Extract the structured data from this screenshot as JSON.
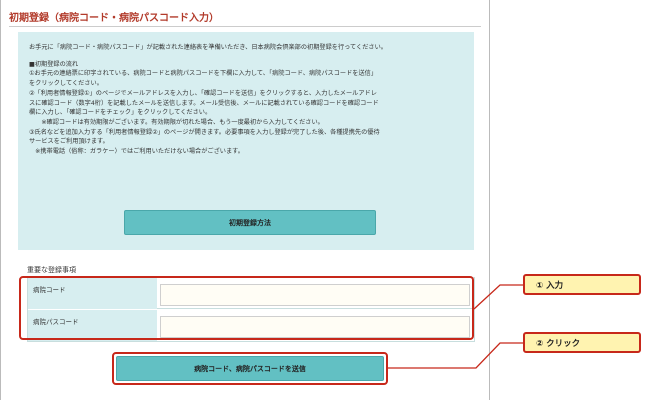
{
  "page": {
    "title": "初期登録（病院コード・病院パスコード入力）"
  },
  "info": {
    "intro": "お手元に「病院コード・病院パスコード」が記載された連絡表を準備いただき、日本病院会倶楽部の初期登録を行ってください。",
    "flow_heading": "■初期登録の流れ",
    "steps": [
      "①お手元の連絡票に印字されている、病院コードと病院パスコードを下欄に入力して、「病院コード、病院パスコードを送信」",
      "をクリックしてください。",
      "②「利用者情報登録①」のページでメールアドレスを入力し、「確認コードを送信」をクリックすると、入力したメールアドレ",
      "スに確認コード（数字4桁）を記載したメールを送信します。メール受信後、メールに記載されている確認コードを確認コード",
      "欄に入力し、「確認コードをチェック」をクリックしてください。",
      "　　※確認コードは有効期限がございます。有効期限が切れた場合、もう一度最初から入力してください。",
      "③氏名などを追加入力する「利用者情報登録②」のページが開きます。必要事項を入力し登録が完了した後、各種提携先の優待",
      "サービスをご利用頂けます。",
      "　※携帯電話（俗称：ガラケー）ではご利用いただけない場合がございます。"
    ],
    "method_button": "初期登録方法"
  },
  "form": {
    "section_label": "重要な登録事項",
    "hospital_code_label": "病院コード",
    "hospital_code_value": "",
    "hospital_passcode_label": "病院パスコード",
    "hospital_passcode_value": "",
    "submit_button": "病院コード、病院パスコードを送信"
  },
  "annotations": {
    "callout_input": "① 入力",
    "callout_click": "② クリック",
    "highlight_color": "#c7281a",
    "callout_fill": "#fff3b0"
  },
  "theme": {
    "accent": "#62c0c3",
    "panel": "#d7eef0",
    "title_color": "#b23a2a"
  }
}
